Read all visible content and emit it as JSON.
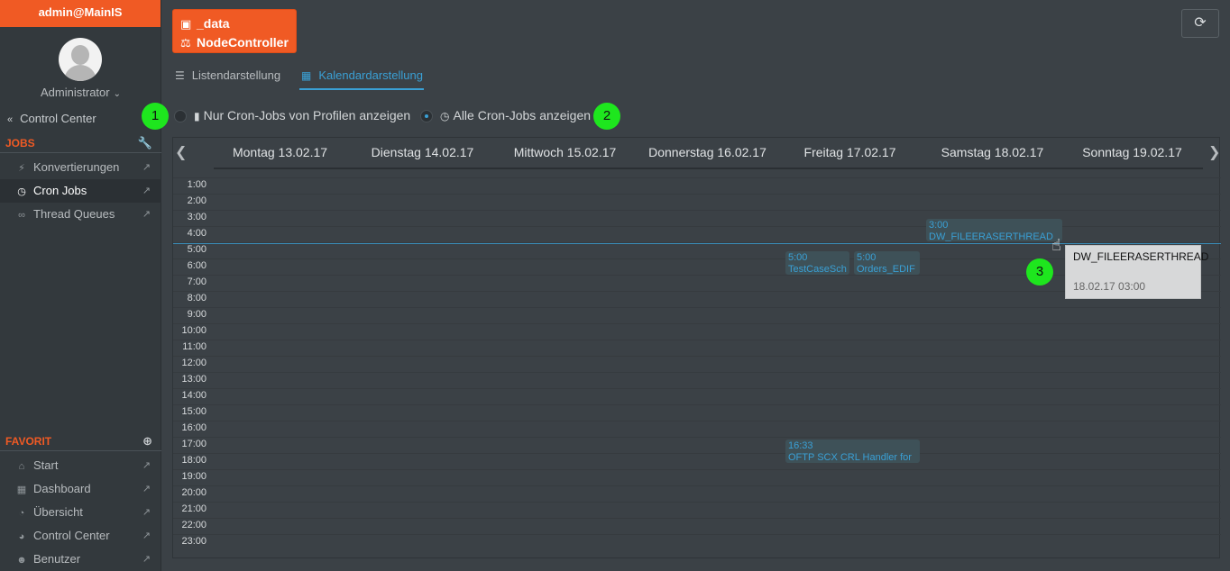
{
  "sidebar": {
    "user": "admin@MainIS",
    "role": "Administrator",
    "back_label": "Control Center",
    "jobs_section": "JOBS",
    "jobs_items": [
      {
        "label": "Konvertierungen",
        "icon": "bolt-icon"
      },
      {
        "label": "Cron Jobs",
        "icon": "clock-icon"
      },
      {
        "label": "Thread Queues",
        "icon": "chain-icon"
      }
    ],
    "favorit_section": "FAVORIT",
    "favorit_items": [
      {
        "label": "Start",
        "icon": "home-icon"
      },
      {
        "label": "Dashboard",
        "icon": "grid-icon"
      },
      {
        "label": "Übersicht",
        "icon": "pie-icon"
      },
      {
        "label": "Control Center",
        "icon": "gauge-icon"
      },
      {
        "label": "Benutzer",
        "icon": "users-icon"
      }
    ]
  },
  "header": {
    "node_line1": "_data",
    "node_line2": "NodeController"
  },
  "tabs": {
    "list": "Listendarstellung",
    "calendar": "Kalendardarstellung",
    "active": "calendar"
  },
  "filters": {
    "badge1": "1",
    "badge2": "2",
    "option1": "Nur Cron-Jobs von Profilen anzeigen",
    "option2": "Alle Cron-Jobs anzeigen",
    "selected": "option2"
  },
  "calendar": {
    "days": [
      "Montag 13.02.17",
      "Dienstag 14.02.17",
      "Mittwoch 15.02.17",
      "Donnerstag 16.02.17",
      "Freitag 17.02.17",
      "Samstag 18.02.17",
      "Sonntag 19.02.17"
    ],
    "hours": [
      "1:00",
      "2:00",
      "3:00",
      "4:00",
      "5:00",
      "6:00",
      "7:00",
      "8:00",
      "9:00",
      "10:00",
      "11:00",
      "12:00",
      "13:00",
      "14:00",
      "15:00",
      "16:00",
      "17:00",
      "18:00",
      "19:00",
      "20:00",
      "21:00",
      "22:00",
      "23:00"
    ],
    "events": [
      {
        "time": "3:00",
        "title": "DW_FILEERASERTHREAD"
      },
      {
        "time": "5:00",
        "title": "TestCaseSch"
      },
      {
        "time": "5:00",
        "title": "Orders_EDIF"
      },
      {
        "time": "16:33",
        "title": "OFTP SCX CRL Handler for"
      }
    ]
  },
  "tooltip": {
    "badge": "3",
    "title": "DW_FILEERASERTHREAD",
    "date": "18.02.17 03:00"
  },
  "colors": {
    "accent": "#f05a24",
    "link": "#3aa0d5",
    "badge": "#1ee61e"
  }
}
